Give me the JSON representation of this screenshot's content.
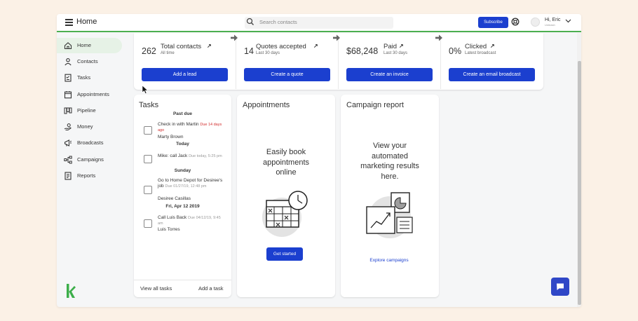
{
  "header": {
    "title": "Home",
    "search_placeholder": "Search contacts",
    "subscribe_label": "Subscribe",
    "user_name": "Hi, Eric",
    "user_sub": "Unleash"
  },
  "sidebar": {
    "items": [
      {
        "label": "Home",
        "icon": "home-icon",
        "active": true
      },
      {
        "label": "Contacts",
        "icon": "person-icon"
      },
      {
        "label": "Tasks",
        "icon": "checklist-icon"
      },
      {
        "label": "Appointments",
        "icon": "calendar-icon"
      },
      {
        "label": "Pipeline",
        "icon": "pipeline-icon"
      },
      {
        "label": "Money",
        "icon": "money-hand-icon"
      },
      {
        "label": "Broadcasts",
        "icon": "megaphone-icon"
      },
      {
        "label": "Campaigns",
        "icon": "flow-icon"
      },
      {
        "label": "Reports",
        "icon": "report-icon"
      }
    ]
  },
  "stats": [
    {
      "value": "262",
      "label": "Total contacts",
      "sub": "All time",
      "button": "Add a lead"
    },
    {
      "value": "14",
      "label": "Quotes accepted",
      "sub": "Last 30 days",
      "button": "Create a quote"
    },
    {
      "value": "$68,248",
      "label": "Paid",
      "sub": "Last 30 days",
      "button": "Create an invoice"
    },
    {
      "value": "0%",
      "label": "Clicked",
      "sub": "Latest broadcast",
      "button": "Create an email broadcast"
    }
  ],
  "tasks": {
    "title": "Tasks",
    "groups": [
      "Past due",
      "Today",
      "Sunday",
      "Fri, Apr 12 2019"
    ],
    "items": [
      {
        "text": "Check in with Martin",
        "due": "Due 14 days ago",
        "who": "Marty Brown"
      },
      {
        "text": "Mike: call Jack",
        "due": "Due today, 5:25 pm",
        "who": ""
      },
      {
        "text": "Go to Home Depot for Desiree's job",
        "due": "Due 01/27/19, 12:48 pm",
        "who": "Desiree Casillas"
      },
      {
        "text": "Call Luis Back",
        "due": "Due 04/12/19, 9:45 am",
        "who": "Luis Torres"
      }
    ],
    "view_all": "View all tasks",
    "add_task": "Add a task"
  },
  "appointments": {
    "title": "Appointments",
    "promo": "Easily book appointments online",
    "button": "Get started"
  },
  "campaign": {
    "title": "Campaign report",
    "promo": "View your automated marketing results here.",
    "link": "Explore campaigns"
  },
  "colors": {
    "accent": "#1b3fcf",
    "brand_green": "#4caf50",
    "overdue": "#d32f2f"
  }
}
